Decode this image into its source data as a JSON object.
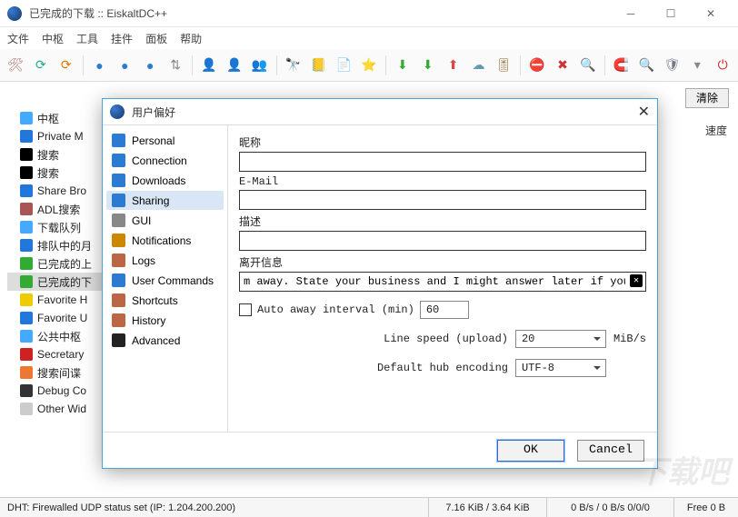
{
  "window": {
    "title": "已完成的下载 :: EiskaltDC++"
  },
  "menu": [
    "文件",
    "中枢",
    "工具",
    "挂件",
    "面板",
    "帮助"
  ],
  "toolbar_icons": [
    "wrench",
    "refresh-green",
    "refresh-orange",
    "globe1",
    "globe2",
    "globe3",
    "arrows",
    "user-blue",
    "user-gold",
    "users",
    "binoc",
    "book",
    "page",
    "star",
    "download",
    "dl-list",
    "upload",
    "cloud",
    "slider",
    "stop",
    "cross",
    "zoom",
    "magnet",
    "search",
    "shield",
    "funnel",
    "power"
  ],
  "clear_button": "清除",
  "speed_header": "速度",
  "tree": [
    {
      "label": "中枢",
      "sel": false
    },
    {
      "label": "Private M",
      "sel": false
    },
    {
      "label": "搜索",
      "sel": false
    },
    {
      "label": "搜索",
      "sel": false
    },
    {
      "label": "Share Bro",
      "sel": false
    },
    {
      "label": "ADL搜索",
      "sel": false
    },
    {
      "label": "下载队列",
      "sel": false
    },
    {
      "label": "排队中的月",
      "sel": false
    },
    {
      "label": "已完成的上",
      "sel": false
    },
    {
      "label": "已完成的下",
      "sel": true
    },
    {
      "label": "Favorite H",
      "sel": false
    },
    {
      "label": "Favorite U",
      "sel": false
    },
    {
      "label": "公共中枢",
      "sel": false
    },
    {
      "label": "Secretary",
      "sel": false
    },
    {
      "label": "搜索间谍",
      "sel": false
    },
    {
      "label": "Debug Co",
      "sel": false
    },
    {
      "label": "Other Wid",
      "sel": false
    }
  ],
  "dialog": {
    "title": "用户偏好",
    "nav": [
      "Personal",
      "Connection",
      "Downloads",
      "Sharing",
      "GUI",
      "Notifications",
      "Logs",
      "User Commands",
      "Shortcuts",
      "History",
      "Advanced"
    ],
    "nav_selected": 3,
    "labels": {
      "nick": "昵称",
      "email": "E-Mail",
      "desc": "描述",
      "away": "离开信息",
      "auto_away": "Auto away interval (min)",
      "line_speed": "Line speed (upload)",
      "mibs": "MiB/s",
      "encoding": "Default hub encoding"
    },
    "values": {
      "nick": "",
      "email": "",
      "desc": "",
      "away": "m away. State your business and I might answer later if you're lucky.",
      "auto_away_checked": false,
      "auto_away_min": "60",
      "line_speed": "20",
      "encoding": "UTF-8"
    },
    "buttons": {
      "ok": "OK",
      "cancel": "Cancel"
    }
  },
  "status": {
    "dht": "DHT: Firewalled UDP status set (IP: 1.204.200.200)",
    "size": "7.16 KiB / 3.64 KiB",
    "rates": "0 B/s / 0 B/s 0/0/0",
    "free": "Free 0 B"
  },
  "watermark": "下载吧"
}
